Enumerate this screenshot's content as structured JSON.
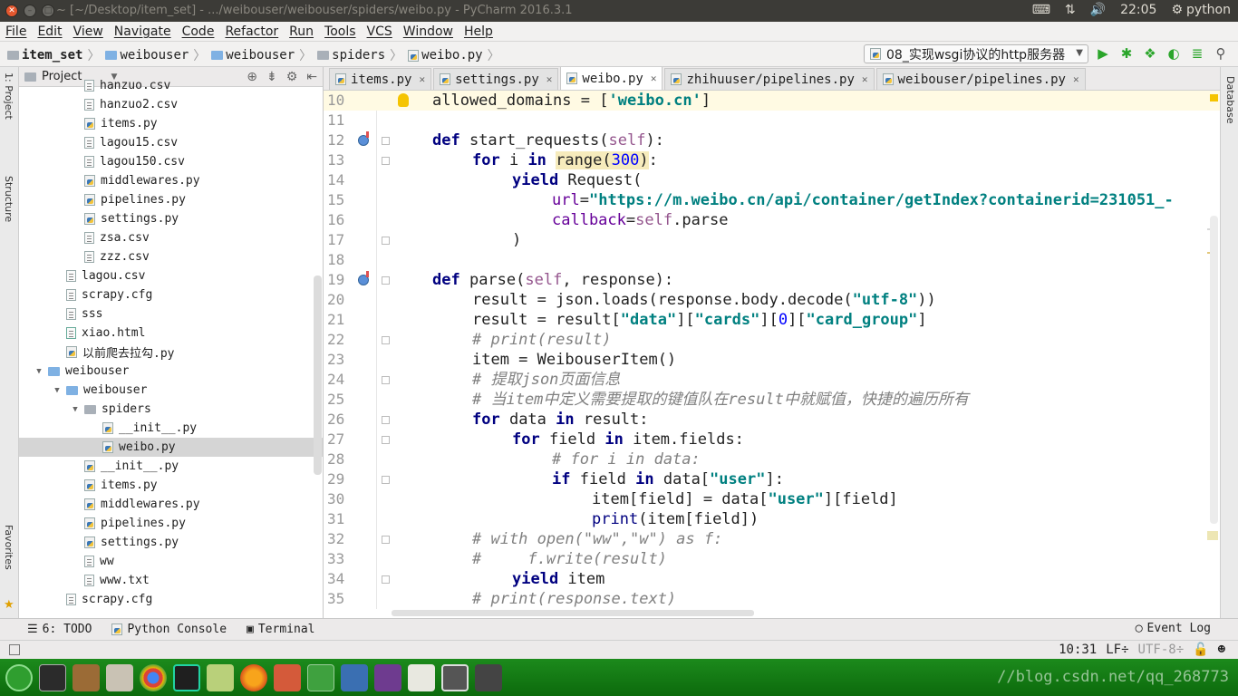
{
  "titlebar": {
    "title": "~ [~/Desktop/item_set] - .../weibouser/weibouser/spiders/weibo.py - PyCharm 2016.3.1",
    "clock": "22:05",
    "session": "python"
  },
  "menu": [
    "File",
    "Edit",
    "View",
    "Navigate",
    "Code",
    "Refactor",
    "Run",
    "Tools",
    "VCS",
    "Window",
    "Help"
  ],
  "breadcrumbs": [
    "item_set",
    "weibouser",
    "weibouser",
    "spiders",
    "weibo.py"
  ],
  "run_config": "08_实现wsgi协议的http服务器",
  "project_panel": {
    "title": "Project",
    "items": [
      {
        "label": "hanzuo.csv",
        "kind": "txt",
        "level": 3
      },
      {
        "label": "hanzuo2.csv",
        "kind": "txt",
        "level": 3
      },
      {
        "label": "items.py",
        "kind": "py",
        "level": 3
      },
      {
        "label": "lagou15.csv",
        "kind": "txt",
        "level": 3
      },
      {
        "label": "lagou150.csv",
        "kind": "txt",
        "level": 3
      },
      {
        "label": "middlewares.py",
        "kind": "py",
        "level": 3
      },
      {
        "label": "pipelines.py",
        "kind": "py",
        "level": 3
      },
      {
        "label": "settings.py",
        "kind": "py",
        "level": 3
      },
      {
        "label": "zsa.csv",
        "kind": "txt",
        "level": 3
      },
      {
        "label": "zzz.csv",
        "kind": "txt",
        "level": 3
      },
      {
        "label": "lagou.csv",
        "kind": "txt",
        "level": 2
      },
      {
        "label": "scrapy.cfg",
        "kind": "txt",
        "level": 2
      },
      {
        "label": "sss",
        "kind": "txt",
        "level": 2
      },
      {
        "label": "xiao.html",
        "kind": "html",
        "level": 2
      },
      {
        "label": "以前爬去拉勾.py",
        "kind": "py",
        "level": 2
      },
      {
        "label": "weibouser",
        "kind": "folder",
        "level": 1
      },
      {
        "label": "weibouser",
        "kind": "folder",
        "level": 2
      },
      {
        "label": "spiders",
        "kind": "folder-gray",
        "level": 3
      },
      {
        "label": "__init__.py",
        "kind": "py",
        "level": 4
      },
      {
        "label": "weibo.py",
        "kind": "py",
        "level": 4
      },
      {
        "label": "__init__.py",
        "kind": "py",
        "level": 3
      },
      {
        "label": "items.py",
        "kind": "py",
        "level": 3
      },
      {
        "label": "middlewares.py",
        "kind": "py",
        "level": 3
      },
      {
        "label": "pipelines.py",
        "kind": "py",
        "level": 3
      },
      {
        "label": "settings.py",
        "kind": "py",
        "level": 3
      },
      {
        "label": "ww",
        "kind": "txt",
        "level": 3
      },
      {
        "label": "www.txt",
        "kind": "txt",
        "level": 3
      },
      {
        "label": "scrapy.cfg",
        "kind": "txt",
        "level": 2
      }
    ]
  },
  "tabs": [
    {
      "label": "items.py",
      "active": false
    },
    {
      "label": "settings.py",
      "active": false
    },
    {
      "label": "weibo.py",
      "active": true
    },
    {
      "label": "zhihuuser/pipelines.py",
      "active": false
    },
    {
      "label": "weibouser/pipelines.py",
      "active": false
    }
  ],
  "code_lines": [
    {
      "n": "10",
      "html": "<span style=\"position:relative\">allowed_domains = [<span class=\"s\">'weibo.cn'</span>]</span>",
      "indent": 0
    },
    {
      "n": "11",
      "html": "",
      "indent": 0
    },
    {
      "n": "12",
      "html": "<span class=\"k\">def</span> start_requests(<span class=\"slf\">self</span>):",
      "indent": 0
    },
    {
      "n": "13",
      "html": "<span class=\"k\">for</span> i <span class=\"k\">in</span> <span class=\"hlbox\">range(<span class=\"n\">300</span>)</span>:",
      "indent": 1
    },
    {
      "n": "14",
      "html": "<span class=\"k\">yield</span> Request(",
      "indent": 2
    },
    {
      "n": "15",
      "html": "<span class=\"kw\">url</span>=<span class=\"s\">\"https://m.weibo.cn/api/container/getIndex?containerid=231051_-</span>",
      "indent": 3
    },
    {
      "n": "16",
      "html": "<span class=\"kw\">callback</span>=<span class=\"slf\">self</span>.parse",
      "indent": 3
    },
    {
      "n": "17",
      "html": ")",
      "indent": 2
    },
    {
      "n": "18",
      "html": "",
      "indent": 0
    },
    {
      "n": "19",
      "html": "<span class=\"k\">def</span> parse(<span class=\"slf\">self</span>, response):",
      "indent": 0
    },
    {
      "n": "20",
      "html": "result = json.loads(response.body.decode(<span class=\"s\">\"utf-8\"</span>))",
      "indent": 1
    },
    {
      "n": "21",
      "html": "result = result[<span class=\"s\">\"data\"</span>][<span class=\"s\">\"cards\"</span>][<span class=\"n\">0</span>][<span class=\"s\">\"card_group\"</span>]",
      "indent": 1
    },
    {
      "n": "22",
      "html": "<span class=\"c\"># print(result)</span>",
      "indent": 1
    },
    {
      "n": "23",
      "html": "item = WeibouserItem()",
      "indent": 1
    },
    {
      "n": "24",
      "html": "<span class=\"c\"># 提取json页面信息</span>",
      "indent": 1
    },
    {
      "n": "25",
      "html": "<span class=\"c\"># 当item中定义需要提取的键值队在result中就赋值，快捷的遍历所有</span>",
      "indent": 1
    },
    {
      "n": "26",
      "html": "<span class=\"k\">for</span> data <span class=\"k\">in</span> result:",
      "indent": 1
    },
    {
      "n": "27",
      "html": "<span class=\"k\">for</span> field <span class=\"k\">in</span> item.fields:",
      "indent": 2
    },
    {
      "n": "28",
      "html": "<span class=\"c\"># for i in data:</span>",
      "indent": 3
    },
    {
      "n": "29",
      "html": "<span class=\"k\">if</span> field <span class=\"k\">in</span> data[<span class=\"s\">\"user\"</span>]:",
      "indent": 3
    },
    {
      "n": "30",
      "html": "item[field] = data[<span class=\"s\">\"user\"</span>][field]",
      "indent": 4
    },
    {
      "n": "31",
      "html": "<span class=\"bi\">print</span>(item[field])",
      "indent": 4
    },
    {
      "n": "32",
      "html": "<span class=\"c\"># with open(\"ww\",\"w\") as f:</span>",
      "indent": 1
    },
    {
      "n": "33",
      "html": "<span class=\"c\">#     f.write(result)</span>",
      "indent": 1
    },
    {
      "n": "34",
      "html": "<span class=\"k\">yield</span> item",
      "indent": 2
    },
    {
      "n": "35",
      "html": "<span class=\"c\"># print(response.text)</span>",
      "indent": 1
    }
  ],
  "bottom_tools": {
    "todo": "6: TODO",
    "console": "Python Console",
    "terminal": "Terminal",
    "event_log": "Event Log"
  },
  "status": {
    "position": "10:31",
    "line_sep": "LF÷",
    "encoding": "UTF-8÷"
  },
  "left_strip": {
    "structure": "Structure",
    "favorites": "Favorites"
  },
  "right_strip": {
    "database": "Database"
  },
  "watermark": "//blog.csdn.net/qq_268773",
  "colors": {
    "launcher_bg": "#1c8a1c",
    "keyword": "#000080",
    "string": "#008080"
  }
}
